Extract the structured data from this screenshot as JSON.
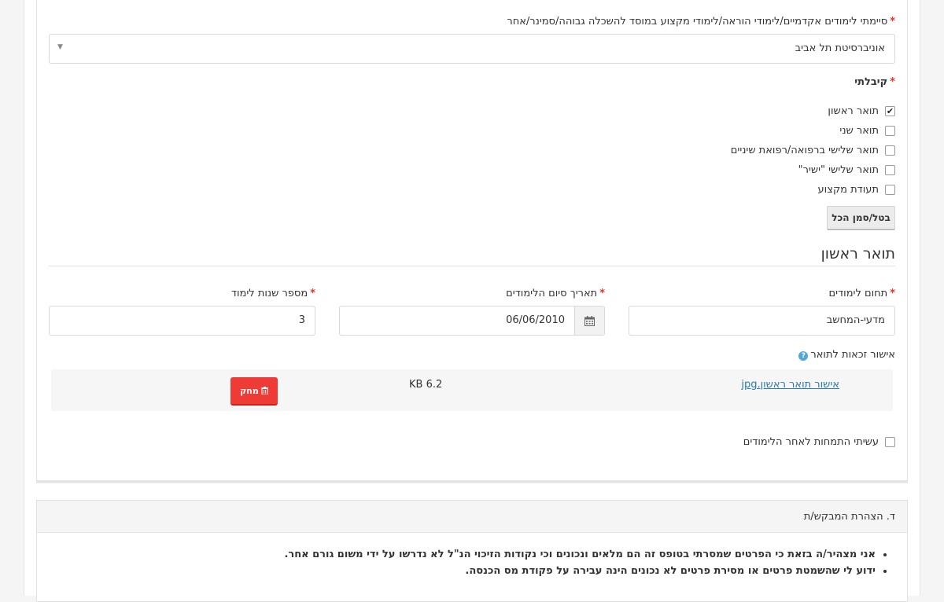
{
  "degrees_institution": {
    "label": "סיימתי לימודים אקדמיים/לימודי הוראה/לימודי מקצוע במוסד להשכלה גבוהה/סמינר/אחר",
    "required_mark": "*",
    "selected_value": "אוניברסיטת תל אביב"
  },
  "received": {
    "label": "קיבלתי",
    "required_mark": "*",
    "options": [
      {
        "label": "תואר ראשון",
        "checked": true
      },
      {
        "label": "תואר שני",
        "checked": false
      },
      {
        "label": "תואר שלישי ברפואה/רפואת שיניים",
        "checked": false
      },
      {
        "label": "תואר שלישי \"ישיר\"",
        "checked": false
      },
      {
        "label": "תעודת מקצוע",
        "checked": false
      }
    ],
    "toggle_all_label": "בטל/סמן הכל"
  },
  "first_degree": {
    "heading": "תואר ראשון",
    "field_label": "תחום לימודים",
    "field_value": "מדעי-המחשב",
    "end_date_label": "תאריך סיום הלימודים",
    "end_date_value": "06/06/2010",
    "years_label": "מספר שנות לימוד",
    "years_value": "3",
    "required_mark": "*",
    "eligibility_label": "אישור זכאות לתואר",
    "help_glyph": "?",
    "file": {
      "name": "אישור תואר ראשון.jpg",
      "size": "6.2 KB",
      "delete_label": "מחק"
    },
    "specialization_label": "עשיתי התמחות לאחר הלימודים",
    "specialization_checked": false
  },
  "declaration": {
    "title": "ד. הצהרת המבקש/ת",
    "items": [
      "אני מצהיר/ה בזאת כי הפרטים שמסרתי בטופס זה הם מלאים ונכונים וכי נקודות הזיכוי הנ\"ל לא נדרשו על ידי משום גורם אחר.",
      "ידוע לי שהשמטת פרטים או מסירת פרטים לא נכונים הינה עבירה על פקודת מס הכנסה."
    ]
  },
  "icons": {
    "checkbox_check": "✔",
    "select_arrow": "▼",
    "calendar": "calendar-icon",
    "trash": "trash-icon"
  },
  "colors": {
    "required": "#e4322b",
    "delete_button": "#ef3b35",
    "link": "#2a7ab3",
    "help": "#4fa7dc"
  }
}
